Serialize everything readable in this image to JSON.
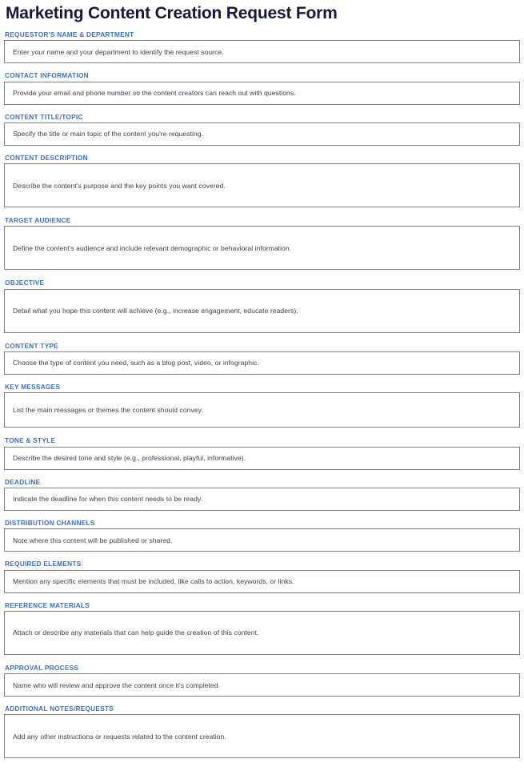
{
  "document": {
    "title": "Marketing Content Creation Request Form"
  },
  "theme": {
    "title_color": "#15183c",
    "label_color": "#3c6fc4",
    "hint_color": "#3d3d4e",
    "border_color": "#828282",
    "background_color": "#ffffff"
  },
  "fields": [
    {
      "label": "REQUESTOR'S NAME & DEPARTMENT",
      "hint": "Enter your name and your department to identify the request source.",
      "size": "size-s",
      "gap": "gap-s"
    },
    {
      "label": "CONTACT INFORMATION",
      "hint": "Provide your email and phone number so the content creators can reach out with questions.",
      "size": "size-s",
      "gap": "gap-s"
    },
    {
      "label": "CONTENT TITLE/TOPIC",
      "hint": "Specify the title or main topic of the content you're requesting.",
      "size": "size-s",
      "gap": "gap-s"
    },
    {
      "label": "CONTENT DESCRIPTION",
      "hint": "Describe the content's purpose and the key points you want covered.",
      "size": "size-l",
      "gap": "gap-m"
    },
    {
      "label": "TARGET AUDIENCE",
      "hint": "Define the content's audience and include relevant demographic or behavioral information.",
      "size": "size-l",
      "gap": "gap-m"
    },
    {
      "label": "OBJECTIVE",
      "hint": "Detail what you hope this content will achieve (e.g., increase engagement, educate readers).",
      "size": "size-l",
      "gap": "gap-m"
    },
    {
      "label": "CONTENT TYPE",
      "hint": "Choose the type of content you need, such as a blog post, video, or infographic.",
      "size": "size-s",
      "gap": "gap-s"
    },
    {
      "label": "KEY MESSAGES",
      "hint": "List the main messages or themes the content should convey.",
      "size": "size-m",
      "gap": "gap-m"
    },
    {
      "label": "TONE & STYLE",
      "hint": "Describe the desired tone and style (e.g., professional, playful, informative).",
      "size": "size-s",
      "gap": "gap-s"
    },
    {
      "label": "DEADLINE",
      "hint": "Indicate the deadline for when this content needs to be ready.",
      "size": "size-s",
      "gap": "gap-s"
    },
    {
      "label": "DISTRIBUTION CHANNELS",
      "hint": "Note where this content will be published or shared.",
      "size": "size-s",
      "gap": "gap-s"
    },
    {
      "label": "REQUIRED ELEMENTS",
      "hint": "Mention any specific elements that must be included, like calls to action, keywords, or links.",
      "size": "size-s",
      "gap": "gap-s"
    },
    {
      "label": "REFERENCE MATERIALS",
      "hint": "Attach or describe any materials that can help guide the creation of this content.",
      "size": "size-l",
      "gap": "gap-m"
    },
    {
      "label": "APPROVAL PROCESS",
      "hint": "Name who will review and approve the content once it's completed.",
      "size": "size-s",
      "gap": "gap-s"
    },
    {
      "label": "ADDITIONAL NOTES/REQUESTS",
      "hint": "Add any other instructions or requests related to the content creation.",
      "size": "size-l",
      "gap": "gap-m"
    }
  ]
}
